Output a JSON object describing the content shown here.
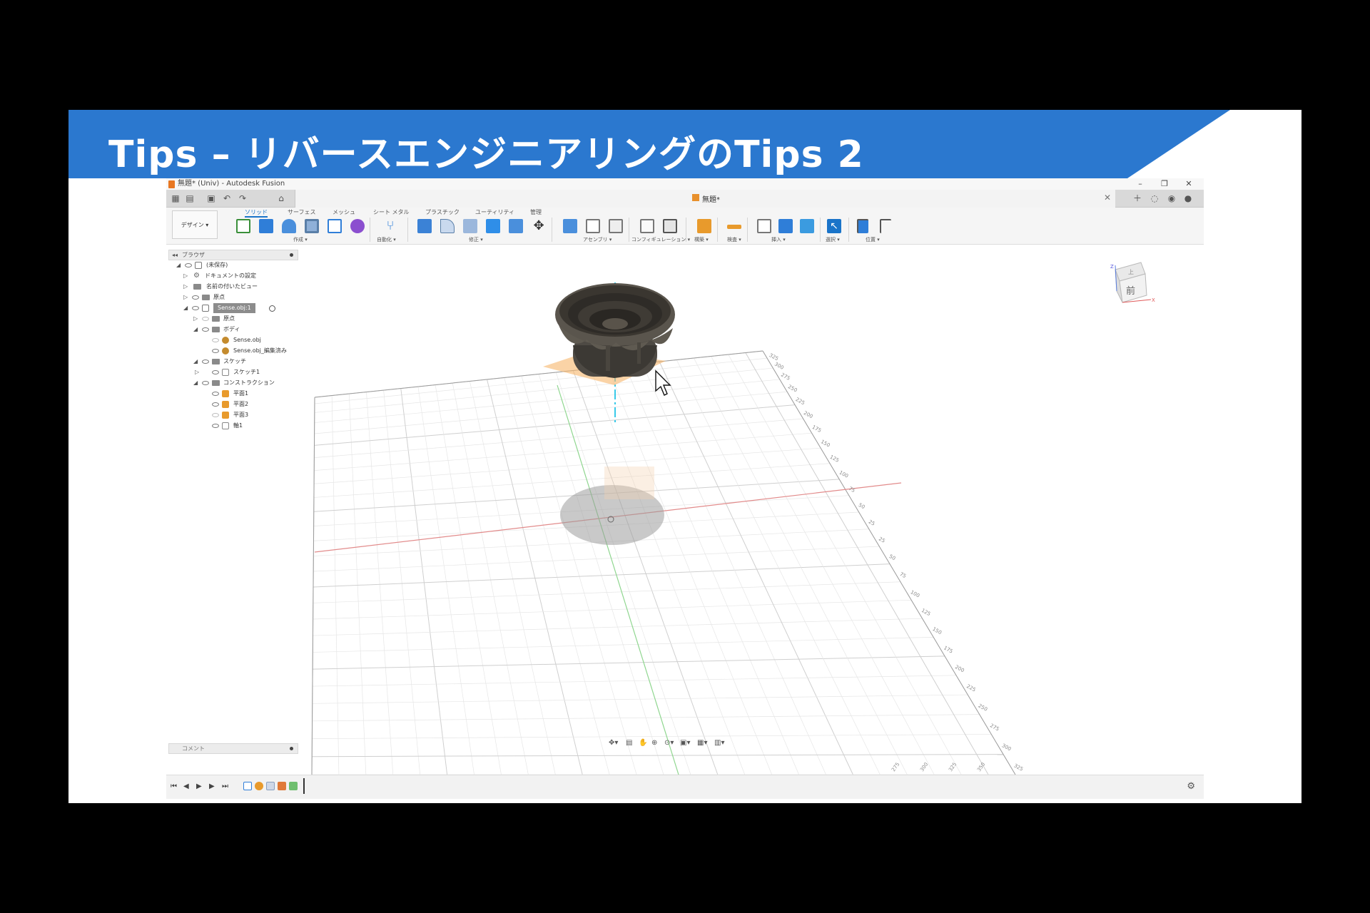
{
  "slide": {
    "title": "Tips – リバースエンジニアリングのTips 2",
    "banner_color": "#2b78cf"
  },
  "window": {
    "title": "無題* (Univ) - Autodesk Fusion",
    "minimize": "–",
    "restore": "❐",
    "close": "✕"
  },
  "document": {
    "tab_name": "無題*",
    "tab_close": "✕"
  },
  "ribbon": {
    "workspace": "デザイン ▾",
    "tabs": [
      "ソリッド",
      "サーフェス",
      "メッシュ",
      "シート メタル",
      "プラスチック",
      "ユーティリティ",
      "管理"
    ],
    "groups": [
      "作成 ▾",
      "自動化 ▾",
      "修正 ▾",
      "アセンブリ ▾",
      "コンフィギュレーション ▾",
      "構築 ▾",
      "検査 ▾",
      "挿入 ▾",
      "選択 ▾",
      "位置 ▾"
    ],
    "accent": "#1a74c9"
  },
  "browser": {
    "title": "ブラウザ",
    "items": [
      {
        "label": "(未保存)"
      },
      {
        "label": "ドキュメントの設定"
      },
      {
        "label": "名前の付いたビュー"
      },
      {
        "label": "原点"
      },
      {
        "label": "Sense.obj:1"
      },
      {
        "label": "原点"
      },
      {
        "label": "ボディ"
      },
      {
        "label": "Sense.obj"
      },
      {
        "label": "Sense.obj_編集済み"
      },
      {
        "label": "スケッチ"
      },
      {
        "label": "スケッチ1"
      },
      {
        "label": "コンストラクション"
      },
      {
        "label": "平面1"
      },
      {
        "label": "平面2"
      },
      {
        "label": "平面3"
      },
      {
        "label": "軸1"
      }
    ]
  },
  "viewcube": {
    "face": "前",
    "top": "上",
    "axis_x": "X",
    "axis_z": "Z"
  },
  "grid": {
    "right_labels": [
      "325",
      "300",
      "275",
      "250",
      "225",
      "200",
      "175",
      "150",
      "125",
      "100",
      "75",
      "50",
      "25",
      "25",
      "50",
      "75",
      "100",
      "125",
      "150",
      "175",
      "200",
      "225",
      "250",
      "275",
      "300",
      "325"
    ],
    "bottom_labels": [
      "275",
      "300",
      "325",
      "350"
    ]
  },
  "comments": {
    "label": "コメント"
  },
  "timeline": {
    "first": "⏮",
    "prev": "◀",
    "play": "▶",
    "next": "▶",
    "last": "⏭",
    "settings": "⚙"
  }
}
